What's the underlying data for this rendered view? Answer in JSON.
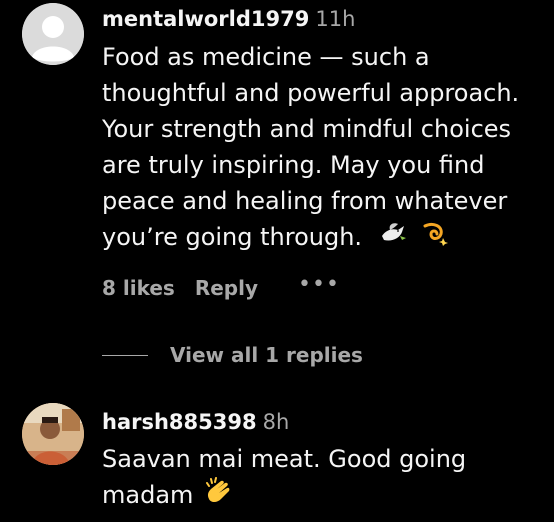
{
  "comments": [
    {
      "username": "mentalworld1979",
      "time": "11h",
      "text_lines": [
        "Food as medicine — such a",
        "thoughtful and powerful approach.",
        "Your strength and mindful choices",
        "are truly inspiring. May you find",
        "peace and healing from whatever",
        "you’re going through."
      ],
      "emojis": [
        "dove-icon",
        "dizzy-icon"
      ],
      "likes": "8 likes",
      "reply_label": "Reply",
      "more_label": "•••",
      "view_replies": "View all 1 replies",
      "avatar": "default-avatar-icon"
    },
    {
      "username": "harsh885398",
      "time": "8h",
      "text_lines": [
        "Saavan mai meat. Good going",
        "madam"
      ],
      "emojis": [
        "clapping-hands-icon"
      ],
      "avatar": "profile-photo"
    }
  ],
  "colors": {
    "background": "#000000",
    "primary_text": "#f5f5f5",
    "secondary_text": "#a8a8a8",
    "default_avatar": "#dbdbdb"
  }
}
